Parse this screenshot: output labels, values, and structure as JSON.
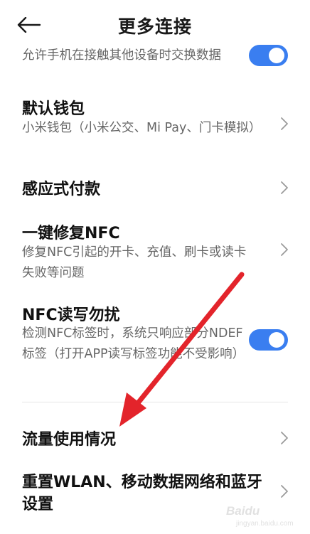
{
  "header": {
    "title": "更多连接",
    "back_icon": "arrow-left-icon"
  },
  "items": [
    {
      "title": "",
      "desc": "允许手机在接触其他设备时交换数据",
      "control": "toggle",
      "toggle_on": true
    },
    {
      "title": "默认钱包",
      "desc": "小米钱包（小米公交、Mi Pay、门卡模拟）",
      "control": "chevron"
    },
    {
      "title": "感应式付款",
      "desc": "",
      "control": "chevron"
    },
    {
      "title": "一键修复NFC",
      "desc": "修复NFC引起的开卡、充值、刷卡或读卡失败等问题",
      "control": "chevron"
    },
    {
      "title": "NFC读写勿扰",
      "desc": "检测NFC标签时，系统只响应部分NDEF标签（打开APP读写标签功能不受影响）",
      "control": "toggle",
      "toggle_on": true
    },
    {
      "title": "流量使用情况",
      "desc": "",
      "control": "chevron"
    },
    {
      "title": "重置WLAN、移动数据网络和蓝牙设置",
      "desc": "",
      "control": "chevron"
    }
  ],
  "watermark": {
    "logo": "Baidu",
    "sub": "jingyan.baidu.com"
  },
  "colors": {
    "toggle_on": "#3a7ef0",
    "annotation_arrow": "#e3242b",
    "desc_text": "#666666"
  }
}
